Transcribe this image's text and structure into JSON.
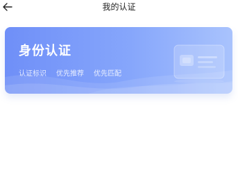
{
  "header": {
    "title": "我的认证"
  },
  "identity_card": {
    "title": "身份认证",
    "tags": [
      "认证标识",
      "优先推荐",
      "优先匹配"
    ]
  },
  "colors": {
    "card_gradient_start": "#6f8ff8",
    "card_gradient_end": "#a9c3fd",
    "text_dark": "#222222",
    "text_light": "#ffffff"
  },
  "icons": {
    "back": "arrow-left-icon",
    "card_illustration": "id-card-icon"
  }
}
